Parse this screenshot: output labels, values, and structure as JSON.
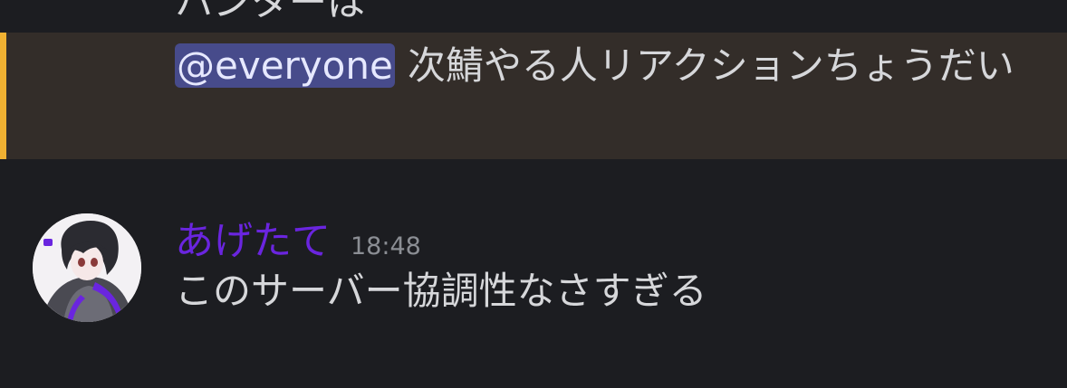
{
  "previous_message": {
    "tail_text": "ハンターは"
  },
  "mention_message": {
    "mention": "@everyone",
    "text": "次鯖やる人リアクションちょうだい",
    "highlight_color": "#f0b132"
  },
  "message": {
    "author": "あげたて",
    "author_color": "#6a25df",
    "timestamp": "18:48",
    "text": "このサーバー協調性なさすぎる",
    "avatar_icon": "user-avatar-icon"
  }
}
